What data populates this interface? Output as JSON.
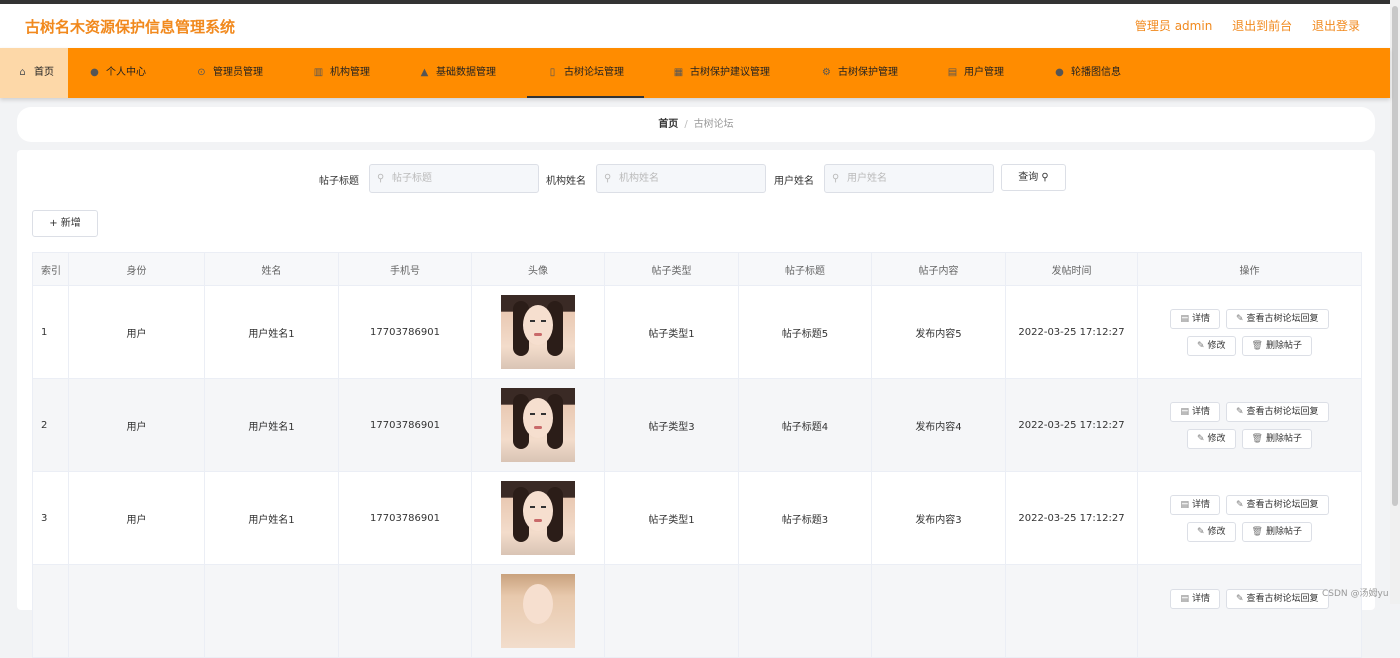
{
  "header": {
    "title": "古树名木资源保护信息管理系统",
    "links": [
      {
        "label": "管理员 admin"
      },
      {
        "label": "退出到前台"
      },
      {
        "label": "退出登录"
      }
    ]
  },
  "nav": {
    "items": [
      {
        "label": "首页",
        "icon": "home-icon",
        "glyph": "⌂"
      },
      {
        "label": "个人中心",
        "icon": "user-icon",
        "glyph": "●"
      },
      {
        "label": "管理员管理",
        "icon": "gear-icon",
        "glyph": "⊙"
      },
      {
        "label": "机构管理",
        "icon": "chart-icon",
        "glyph": "▥"
      },
      {
        "label": "基础数据管理",
        "icon": "people-icon",
        "glyph": "▲"
      },
      {
        "label": "古树论坛管理",
        "icon": "document-icon",
        "glyph": "▯"
      },
      {
        "label": "古树保护建议管理",
        "icon": "grid-icon",
        "glyph": "▦"
      },
      {
        "label": "古树保护管理",
        "icon": "gear-icon",
        "glyph": "⚙"
      },
      {
        "label": "用户管理",
        "icon": "list-icon",
        "glyph": "▤"
      },
      {
        "label": "轮播图信息",
        "icon": "user-icon",
        "glyph": "●"
      }
    ]
  },
  "breadcrumb": {
    "home": "首页",
    "separator": "/",
    "current": "古树论坛"
  },
  "search": {
    "fields": [
      {
        "label": "帖子标题",
        "placeholder": "帖子标题"
      },
      {
        "label": "机构姓名",
        "placeholder": "机构姓名"
      },
      {
        "label": "用户姓名",
        "placeholder": "用户姓名"
      }
    ],
    "query_label": "查询",
    "add_label": "新增",
    "search_glyph": "⚲",
    "add_glyph": "+"
  },
  "table": {
    "columns": [
      "索引",
      "身份",
      "姓名",
      "手机号",
      "头像",
      "帖子类型",
      "帖子标题",
      "帖子内容",
      "发帖时间",
      "操作"
    ],
    "actions": {
      "detail": "详情",
      "view_reply": "查看古树论坛回复",
      "edit": "修改",
      "delete": "删除帖子",
      "detail_glyph": "▤",
      "edit_glyph": "✎",
      "delete_glyph": "🗑"
    },
    "rows": [
      {
        "index": "1",
        "role": "用户",
        "name": "用户姓名1",
        "phone": "17703786901",
        "type": "帖子类型1",
        "title": "帖子标题5",
        "content": "发布内容5",
        "time": "2022-03-25 17:12:27"
      },
      {
        "index": "2",
        "role": "用户",
        "name": "用户姓名1",
        "phone": "17703786901",
        "type": "帖子类型3",
        "title": "帖子标题4",
        "content": "发布内容4",
        "time": "2022-03-25 17:12:27"
      },
      {
        "index": "3",
        "role": "用户",
        "name": "用户姓名1",
        "phone": "17703786901",
        "type": "帖子类型1",
        "title": "帖子标题3",
        "content": "发布内容3",
        "time": "2022-03-25 17:12:27"
      },
      {
        "index": "",
        "role": "",
        "name": "",
        "phone": "",
        "type": "",
        "title": "",
        "content": "",
        "time": ""
      }
    ]
  },
  "watermark": "CSDN @汤姆yu",
  "colors": {
    "accent": "#ff8c00",
    "title": "#f1891d",
    "home_tab": "#fdd8a8"
  }
}
